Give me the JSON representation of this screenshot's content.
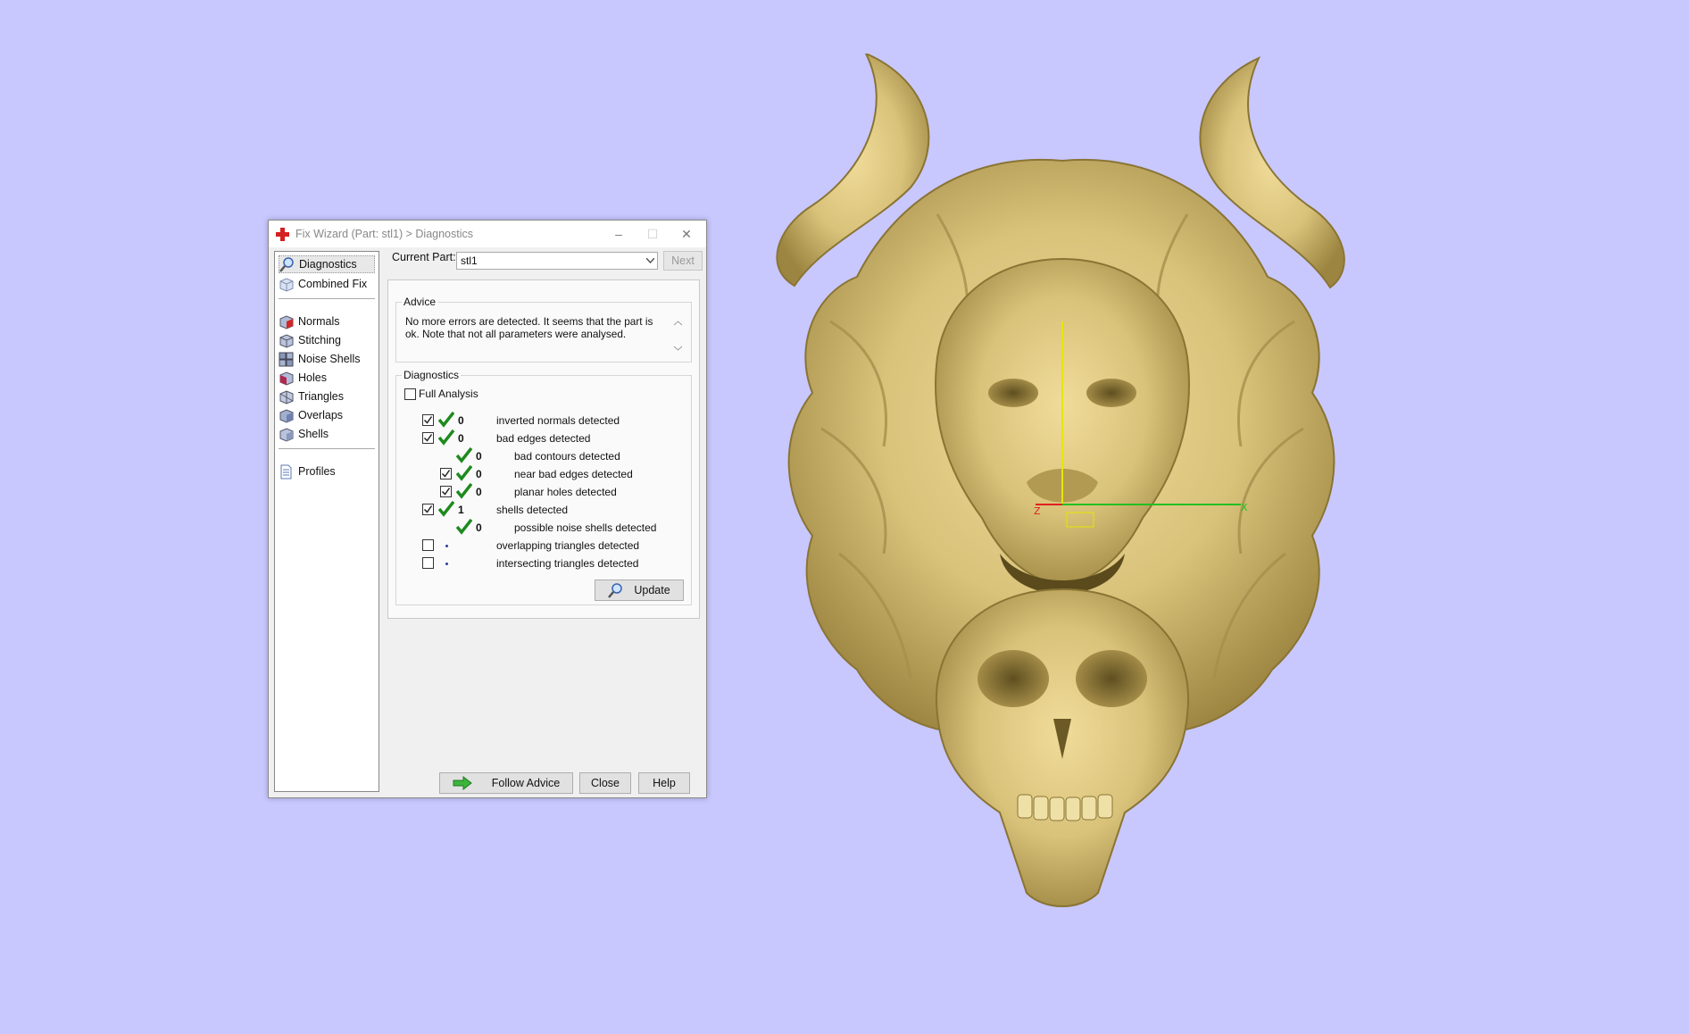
{
  "window": {
    "title": "Fix Wizard (Part: stl1) > Diagnostics",
    "controls": {
      "minimize": "–",
      "maximize": "☐",
      "close": "✕"
    }
  },
  "sidebar": {
    "groups": [
      [
        {
          "label": "Diagnostics",
          "icon": "magnifier-icon",
          "selected": true
        },
        {
          "label": "Combined Fix",
          "icon": "combined-fix-cube-icon"
        }
      ],
      [
        {
          "label": "Normals",
          "icon": "normals-cube-icon"
        },
        {
          "label": "Stitching",
          "icon": "stitching-cube-icon"
        },
        {
          "label": "Noise Shells",
          "icon": "noise-shells-cube-icon"
        },
        {
          "label": "Holes",
          "icon": "holes-cube-icon"
        },
        {
          "label": "Triangles",
          "icon": "triangles-cube-icon"
        },
        {
          "label": "Overlaps",
          "icon": "overlaps-cube-icon"
        },
        {
          "label": "Shells",
          "icon": "shells-cube-icon"
        }
      ],
      [
        {
          "label": "Profiles",
          "icon": "profiles-document-icon"
        }
      ]
    ]
  },
  "current_part": {
    "label": "Current Part:",
    "value": "stl1",
    "next_label": "Next"
  },
  "advice": {
    "legend": "Advice",
    "text": "No more errors are detected. It seems that the part is ok. Note that not all parameters were analysed."
  },
  "diagnostics": {
    "legend": "Diagnostics",
    "full_analysis_label": "Full Analysis",
    "full_analysis_checked": false,
    "rows": [
      {
        "indent": 0,
        "checkbox": true,
        "checked": true,
        "status": "ok",
        "count": "0",
        "text": "inverted normals detected"
      },
      {
        "indent": 0,
        "checkbox": true,
        "checked": true,
        "status": "ok",
        "count": "0",
        "text": "bad edges detected"
      },
      {
        "indent": 1,
        "checkbox": false,
        "checked": false,
        "status": "ok",
        "count": "0",
        "text": "bad contours detected"
      },
      {
        "indent": 1,
        "checkbox": true,
        "checked": true,
        "status": "ok",
        "count": "0",
        "text": "near bad edges detected"
      },
      {
        "indent": 1,
        "checkbox": true,
        "checked": true,
        "status": "ok",
        "count": "0",
        "text": "planar holes detected"
      },
      {
        "indent": 0,
        "checkbox": true,
        "checked": true,
        "status": "ok",
        "count": "1",
        "text": "shells detected"
      },
      {
        "indent": 1,
        "checkbox": false,
        "checked": false,
        "status": "ok",
        "count": "0",
        "text": "possible noise shells detected"
      },
      {
        "indent": 0,
        "checkbox": true,
        "checked": false,
        "status": "pending",
        "count": "",
        "text": "overlapping triangles detected"
      },
      {
        "indent": 0,
        "checkbox": true,
        "checked": false,
        "status": "pending",
        "count": "",
        "text": "intersecting triangles detected"
      }
    ],
    "update_label": "Update"
  },
  "footer": {
    "follow_advice": "Follow Advice",
    "close": "Close",
    "help": "Help"
  },
  "viewport": {
    "model": "lion-skull-relief",
    "axis_label_z": "Z",
    "axis_label_x": "X",
    "colors": {
      "background": "#c8c8ff",
      "model": "#d8c27c",
      "axis_x": "#22c022",
      "axis_y": "#e6e600",
      "axis_z": "#e02020"
    }
  }
}
